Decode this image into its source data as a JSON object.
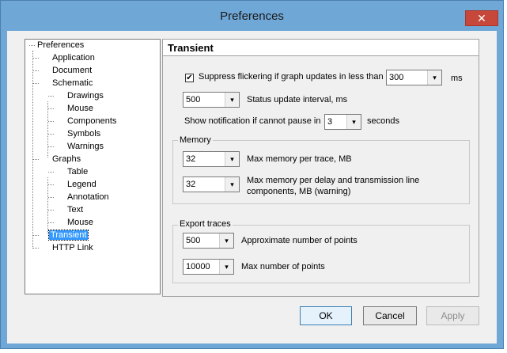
{
  "window": {
    "title": "Preferences",
    "close_label": "✕"
  },
  "tree": {
    "items": [
      {
        "label": "Preferences"
      },
      {
        "label": "Application"
      },
      {
        "label": "Document"
      },
      {
        "label": "Schematic"
      },
      {
        "label": "Drawings"
      },
      {
        "label": "Mouse"
      },
      {
        "label": "Components"
      },
      {
        "label": "Symbols"
      },
      {
        "label": "Warnings"
      },
      {
        "label": "Graphs"
      },
      {
        "label": "Table"
      },
      {
        "label": "Legend"
      },
      {
        "label": "Annotation"
      },
      {
        "label": "Text"
      },
      {
        "label": "Mouse"
      },
      {
        "label": "Transient"
      },
      {
        "label": "HTTP Link"
      }
    ],
    "selected": "Transient"
  },
  "panel": {
    "title": "Transient",
    "suppress_label": "Suppress flickering  if graph updates in less than",
    "suppress_checked": "✔",
    "suppress_value": "300",
    "suppress_unit": "ms",
    "status_value": "500",
    "status_label": "Status update interval, ms",
    "notify_label": "Show notification if cannot pause in",
    "notify_value": "3",
    "notify_unit": "seconds",
    "memory": {
      "title": "Memory",
      "per_trace_value": "32",
      "per_trace_label": "Max memory per trace, MB",
      "per_delay_value": "32",
      "per_delay_label_1": "Max memory per delay and transmission line",
      "per_delay_label_2": "components, MB  (warning)"
    },
    "export": {
      "title": "Export traces",
      "approx_value": "500",
      "approx_label": "Approximate number of points",
      "max_value": "10000",
      "max_label": "Max number of points"
    }
  },
  "buttons": {
    "ok": "OK",
    "cancel": "Cancel",
    "apply": "Apply"
  },
  "icons": {
    "dropdown": "▾"
  }
}
